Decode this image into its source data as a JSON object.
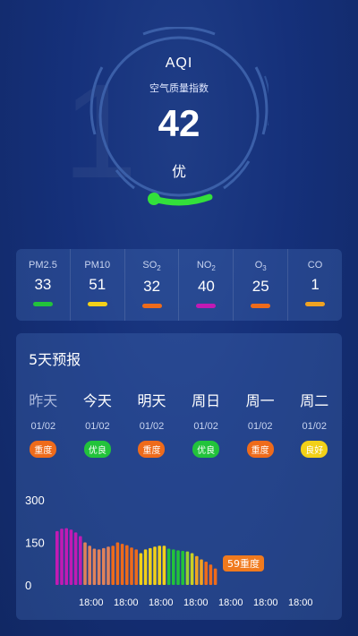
{
  "aqi": {
    "title": "AQI",
    "subtitle": "空气质量指数",
    "value": "42",
    "level": "优"
  },
  "pollutants": [
    {
      "name": "PM2.5",
      "value": "33",
      "color": "#22c33b"
    },
    {
      "name": "PM10",
      "value": "51",
      "color": "#f2d018"
    },
    {
      "name": "SO",
      "sub": "2",
      "value": "32",
      "color": "#ee6b1b"
    },
    {
      "name": "NO",
      "sub": "2",
      "value": "40",
      "color": "#c21ab4"
    },
    {
      "name": "O",
      "sub": "3",
      "value": "25",
      "color": "#ee6b1b"
    },
    {
      "name": "CO",
      "value": "1",
      "color": "#f0a322"
    }
  ],
  "forecast": {
    "title": "5天预报",
    "days": [
      {
        "name": "昨天",
        "date": "01/02",
        "badge": "重度",
        "badge_color": "#ee6b1b",
        "past": true
      },
      {
        "name": "今天",
        "date": "01/02",
        "badge": "优良",
        "badge_color": "#22c33b"
      },
      {
        "name": "明天",
        "date": "01/02",
        "badge": "重度",
        "badge_color": "#ee6b1b"
      },
      {
        "name": "周日",
        "date": "01/02",
        "badge": "优良",
        "badge_color": "#22c33b"
      },
      {
        "name": "周一",
        "date": "01/02",
        "badge": "重度",
        "badge_color": "#ee6b1b"
      },
      {
        "name": "周二",
        "date": "01/02",
        "badge": "良好",
        "badge_color": "#f2d018"
      }
    ]
  },
  "chart_data": {
    "type": "bar",
    "yticks": [
      "300",
      "150",
      "0"
    ],
    "ylim": [
      0,
      300
    ],
    "xtick_labels": [
      "18:00",
      "18:00",
      "18:00",
      "18:00",
      "18:00",
      "18:00",
      "18:00"
    ],
    "values": [
      190,
      198,
      200,
      195,
      185,
      172,
      150,
      138,
      128,
      125,
      130,
      135,
      138,
      150,
      145,
      140,
      132,
      125,
      112,
      125,
      130,
      135,
      138,
      138,
      128,
      125,
      122,
      120,
      118,
      112,
      102,
      90,
      82,
      72,
      58
    ],
    "colors": [
      "#c21ab4",
      "#c21ab4",
      "#c21ab4",
      "#c21ab4",
      "#c21ab4",
      "#c21ab4",
      "#e0825a",
      "#e0825a",
      "#e0825a",
      "#e0825a",
      "#e0825a",
      "#e0825a",
      "#ee6b1b",
      "#ee6b1b",
      "#ee6b1b",
      "#ee6b1b",
      "#ee6b1b",
      "#ee6b1b",
      "#f2d018",
      "#f2d018",
      "#f2d018",
      "#f2d018",
      "#f2d018",
      "#f2d018",
      "#22c33b",
      "#22c33b",
      "#22c33b",
      "#22c33b",
      "#9bd12e",
      "#c9d124",
      "#f0a322",
      "#f0a322",
      "#ee6b1b",
      "#ee6b1b",
      "#ee6b1b"
    ],
    "current_label": "59重度",
    "current_label_color": "#f07a1e"
  }
}
